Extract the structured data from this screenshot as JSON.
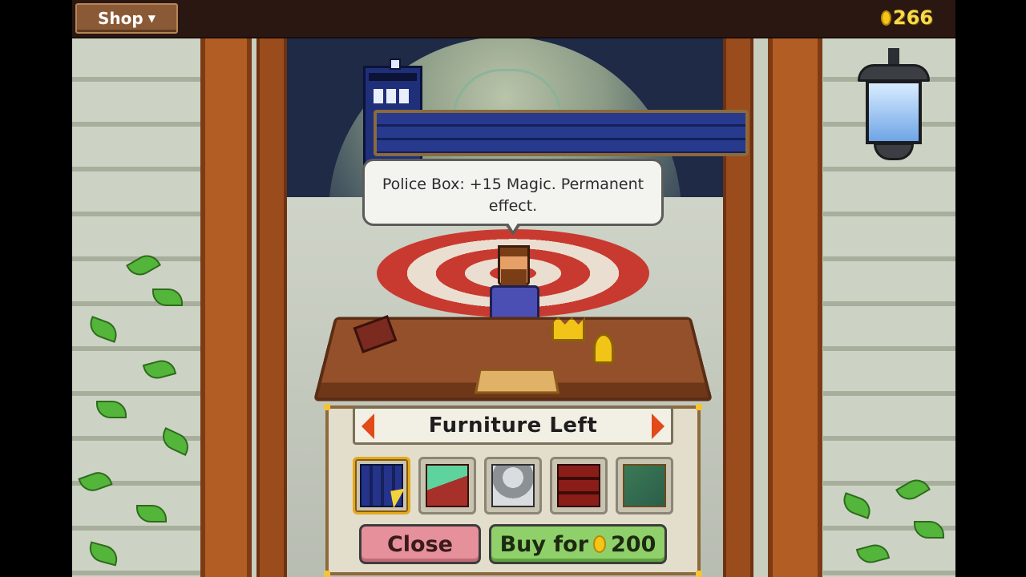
{
  "header": {
    "menu_label": "Shop",
    "gold_amount": "266"
  },
  "tooltip": {
    "text": "Police Box:  +15 Magic. Permanent effect."
  },
  "shop": {
    "category_title": "Furniture Left",
    "items": [
      {
        "name": "police-box",
        "selected": true
      },
      {
        "name": "bed",
        "selected": false
      },
      {
        "name": "armor",
        "selected": false
      },
      {
        "name": "bookshelf",
        "selected": false
      },
      {
        "name": "map",
        "selected": false
      }
    ],
    "close_label": "Close",
    "buy_label": "Buy for",
    "price": "200"
  },
  "colors": {
    "gold": "#f8d948",
    "close_button": "#e6909c",
    "buy_button": "#90d06a",
    "arrow": "#e24a19"
  },
  "icons": {
    "prev": "left-arrow-icon",
    "next": "right-arrow-icon",
    "coin": "coin-icon",
    "caret": "chevron-down-icon"
  }
}
